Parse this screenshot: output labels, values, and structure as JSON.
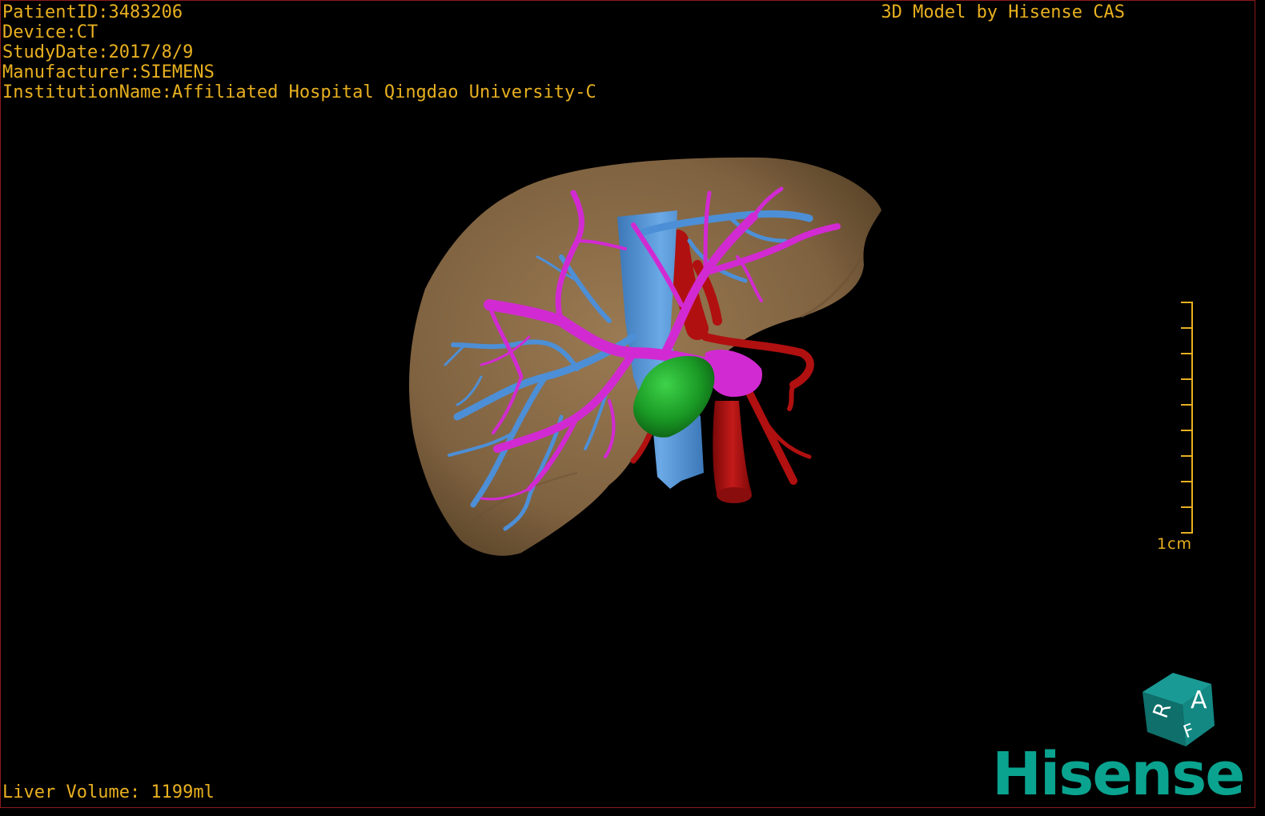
{
  "overlay": {
    "patient_id": "PatientID:3483206",
    "device": "Device:CT",
    "study_date": "StudyDate:2017/8/9",
    "manufacturer": "Manufacturer:SIEMENS",
    "institution": "InstitutionName:Affiliated Hospital Qingdao University-C",
    "model_credit": "3D Model by Hisense CAS",
    "liver_volume": "Liver Volume: 1199ml"
  },
  "scale_bar": {
    "label": "1cm"
  },
  "orientation_cube": {
    "face_front": "A",
    "face_left": "R",
    "face_top": "F"
  },
  "logo": {
    "text": "Hisense"
  },
  "colors": {
    "overlay_text": "#e8b020",
    "liver": "#8c6e4a",
    "portal_vein": "#d22ad2",
    "hepatic_vein": "#4d8fd6",
    "artery": "#b01010",
    "tumor": "#1fa52a",
    "logo": "#0aa38f",
    "cube": "#0f7f7a"
  }
}
